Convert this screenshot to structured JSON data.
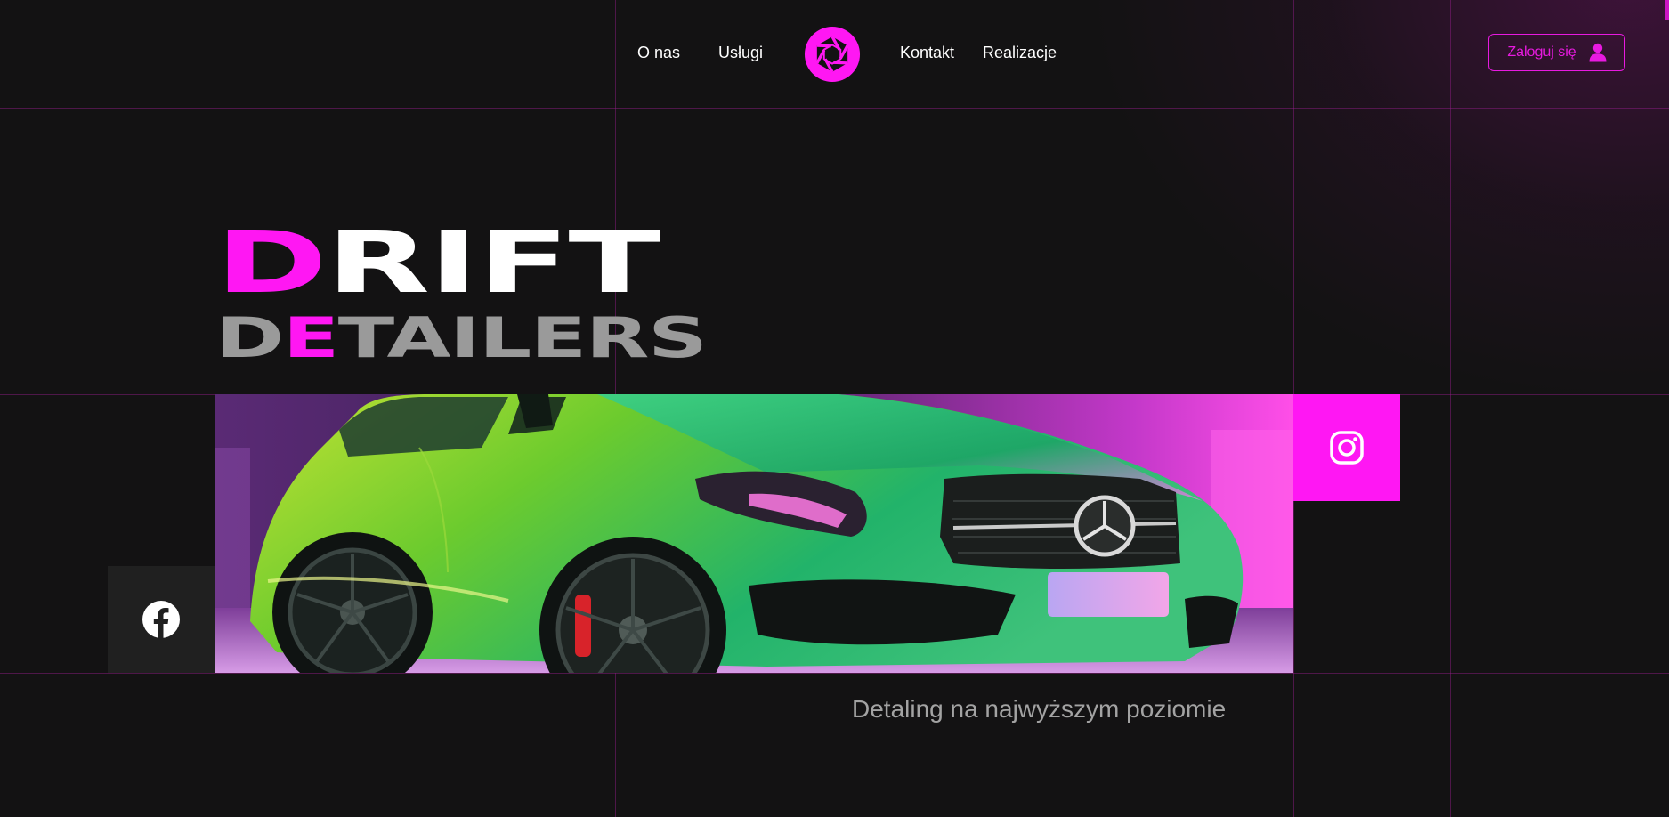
{
  "nav": {
    "left_links": [
      "O nas",
      "Usługi"
    ],
    "right_links": [
      "Kontakt",
      "Realizacje"
    ],
    "logo_icon": "aperture-logo-icon",
    "login_label": "Zaloguj się",
    "login_icon": "user-icon"
  },
  "hero": {
    "title_line1_accent": "D",
    "title_line1_rest": "RIFT",
    "title_line2_start": "D",
    "title_line2_accent": "E",
    "title_line2_rest": "TAILERS",
    "image": "green-mercedes-car-photo",
    "tagline": "Detaling na najwyższym poziomie"
  },
  "social": {
    "instagram_icon": "instagram-icon",
    "facebook_icon": "facebook-icon"
  },
  "colors": {
    "background": "#131213",
    "accent": "#ff17f3",
    "grid_line": "#961e8c",
    "secondary_text": "#9a9a9a"
  }
}
